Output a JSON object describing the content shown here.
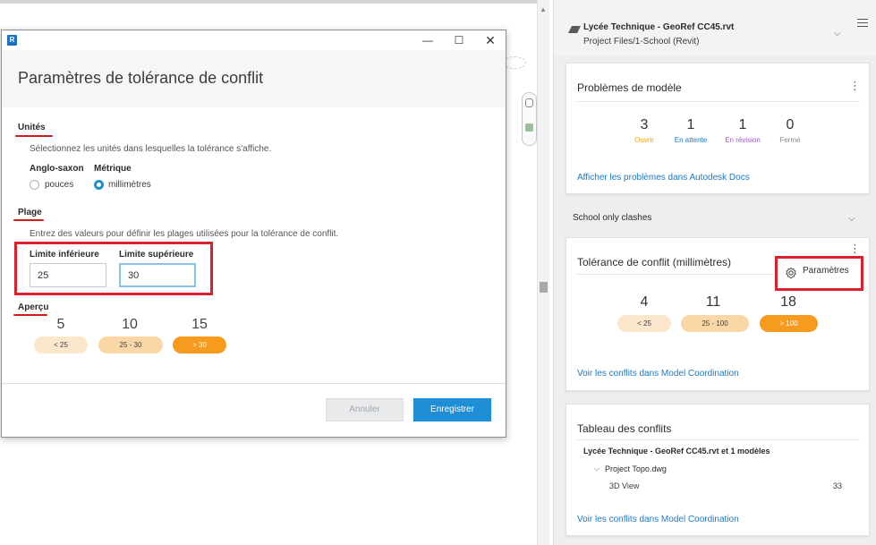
{
  "dialog": {
    "title": "Paramètres de tolérance de conflit",
    "units": {
      "section_title": "Unités",
      "description": "Sélectionnez les unités dans lesquelles la tolérance s'affiche.",
      "imperial_label": "Anglo-saxon",
      "imperial_option": "pouces",
      "metric_label": "Métrique",
      "metric_option": "millimètres",
      "selected": "millimètres"
    },
    "range": {
      "section_title": "Plage",
      "description": "Entrez des valeurs pour définir les plages utilisées pour la tolérance de conflit.",
      "lower_label": "Limite inférieure",
      "lower_value": "25",
      "upper_label": "Limite supérieure",
      "upper_value": "30"
    },
    "preview": {
      "section_title": "Aperçu",
      "items": [
        {
          "count": "5",
          "range": "< 25"
        },
        {
          "count": "10",
          "range": "25 - 30"
        },
        {
          "count": "15",
          "range": "> 30"
        }
      ]
    },
    "cancel_label": "Annuler",
    "save_label": "Enregistrer",
    "window_controls": {
      "minimize": "—",
      "maximize": "☐",
      "close": "✕"
    }
  },
  "panel": {
    "project_name": "Lycée Technique - GeoRef CC45.rvt",
    "project_path": "Project Files/1-School (Revit)",
    "model_issues": {
      "title": "Problèmes de modèle",
      "stats": [
        {
          "count": "3",
          "label": "Ouvrir",
          "color": "#f0a31c"
        },
        {
          "count": "1",
          "label": "En attente",
          "color": "#1e78c2"
        },
        {
          "count": "1",
          "label": "En révision",
          "color": "#9b5fc0"
        },
        {
          "count": "0",
          "label": "Fermé",
          "color": "#8a8a8a"
        }
      ],
      "link": "Afficher les problèmes dans Autodesk Docs"
    },
    "group_label": "School only clashes",
    "tolerance": {
      "title": "Tolérance de conflit (millimètres)",
      "params_label": "Paramètres",
      "items": [
        {
          "count": "4",
          "range": "< 25"
        },
        {
          "count": "11",
          "range": "25 - 100"
        },
        {
          "count": "18",
          "range": "> 100"
        }
      ],
      "link": "Voir les conflits dans Model Coordination"
    },
    "clash_table": {
      "title": "Tableau des conflits",
      "row1": "Lycée Technique - GeoRef CC45.rvt et 1 modèles",
      "row2": "Project Topo.dwg",
      "row3_label": "3D View",
      "row3_count": "33",
      "link": "Voir les conflits dans Model Coordination"
    }
  }
}
